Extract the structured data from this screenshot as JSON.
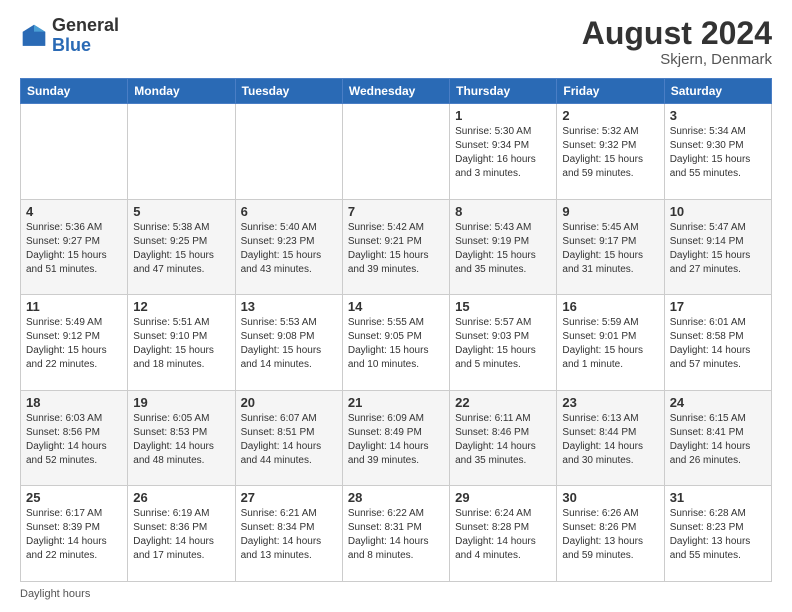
{
  "header": {
    "logo": {
      "general": "General",
      "blue": "Blue"
    },
    "title": "August 2024",
    "location": "Skjern, Denmark"
  },
  "calendar": {
    "days_of_week": [
      "Sunday",
      "Monday",
      "Tuesday",
      "Wednesday",
      "Thursday",
      "Friday",
      "Saturday"
    ],
    "weeks": [
      [
        {
          "day": "",
          "info": ""
        },
        {
          "day": "",
          "info": ""
        },
        {
          "day": "",
          "info": ""
        },
        {
          "day": "",
          "info": ""
        },
        {
          "day": "1",
          "info": "Sunrise: 5:30 AM\nSunset: 9:34 PM\nDaylight: 16 hours and 3 minutes."
        },
        {
          "day": "2",
          "info": "Sunrise: 5:32 AM\nSunset: 9:32 PM\nDaylight: 15 hours and 59 minutes."
        },
        {
          "day": "3",
          "info": "Sunrise: 5:34 AM\nSunset: 9:30 PM\nDaylight: 15 hours and 55 minutes."
        }
      ],
      [
        {
          "day": "4",
          "info": "Sunrise: 5:36 AM\nSunset: 9:27 PM\nDaylight: 15 hours and 51 minutes."
        },
        {
          "day": "5",
          "info": "Sunrise: 5:38 AM\nSunset: 9:25 PM\nDaylight: 15 hours and 47 minutes."
        },
        {
          "day": "6",
          "info": "Sunrise: 5:40 AM\nSunset: 9:23 PM\nDaylight: 15 hours and 43 minutes."
        },
        {
          "day": "7",
          "info": "Sunrise: 5:42 AM\nSunset: 9:21 PM\nDaylight: 15 hours and 39 minutes."
        },
        {
          "day": "8",
          "info": "Sunrise: 5:43 AM\nSunset: 9:19 PM\nDaylight: 15 hours and 35 minutes."
        },
        {
          "day": "9",
          "info": "Sunrise: 5:45 AM\nSunset: 9:17 PM\nDaylight: 15 hours and 31 minutes."
        },
        {
          "day": "10",
          "info": "Sunrise: 5:47 AM\nSunset: 9:14 PM\nDaylight: 15 hours and 27 minutes."
        }
      ],
      [
        {
          "day": "11",
          "info": "Sunrise: 5:49 AM\nSunset: 9:12 PM\nDaylight: 15 hours and 22 minutes."
        },
        {
          "day": "12",
          "info": "Sunrise: 5:51 AM\nSunset: 9:10 PM\nDaylight: 15 hours and 18 minutes."
        },
        {
          "day": "13",
          "info": "Sunrise: 5:53 AM\nSunset: 9:08 PM\nDaylight: 15 hours and 14 minutes."
        },
        {
          "day": "14",
          "info": "Sunrise: 5:55 AM\nSunset: 9:05 PM\nDaylight: 15 hours and 10 minutes."
        },
        {
          "day": "15",
          "info": "Sunrise: 5:57 AM\nSunset: 9:03 PM\nDaylight: 15 hours and 5 minutes."
        },
        {
          "day": "16",
          "info": "Sunrise: 5:59 AM\nSunset: 9:01 PM\nDaylight: 15 hours and 1 minute."
        },
        {
          "day": "17",
          "info": "Sunrise: 6:01 AM\nSunset: 8:58 PM\nDaylight: 14 hours and 57 minutes."
        }
      ],
      [
        {
          "day": "18",
          "info": "Sunrise: 6:03 AM\nSunset: 8:56 PM\nDaylight: 14 hours and 52 minutes."
        },
        {
          "day": "19",
          "info": "Sunrise: 6:05 AM\nSunset: 8:53 PM\nDaylight: 14 hours and 48 minutes."
        },
        {
          "day": "20",
          "info": "Sunrise: 6:07 AM\nSunset: 8:51 PM\nDaylight: 14 hours and 44 minutes."
        },
        {
          "day": "21",
          "info": "Sunrise: 6:09 AM\nSunset: 8:49 PM\nDaylight: 14 hours and 39 minutes."
        },
        {
          "day": "22",
          "info": "Sunrise: 6:11 AM\nSunset: 8:46 PM\nDaylight: 14 hours and 35 minutes."
        },
        {
          "day": "23",
          "info": "Sunrise: 6:13 AM\nSunset: 8:44 PM\nDaylight: 14 hours and 30 minutes."
        },
        {
          "day": "24",
          "info": "Sunrise: 6:15 AM\nSunset: 8:41 PM\nDaylight: 14 hours and 26 minutes."
        }
      ],
      [
        {
          "day": "25",
          "info": "Sunrise: 6:17 AM\nSunset: 8:39 PM\nDaylight: 14 hours and 22 minutes."
        },
        {
          "day": "26",
          "info": "Sunrise: 6:19 AM\nSunset: 8:36 PM\nDaylight: 14 hours and 17 minutes."
        },
        {
          "day": "27",
          "info": "Sunrise: 6:21 AM\nSunset: 8:34 PM\nDaylight: 14 hours and 13 minutes."
        },
        {
          "day": "28",
          "info": "Sunrise: 6:22 AM\nSunset: 8:31 PM\nDaylight: 14 hours and 8 minutes."
        },
        {
          "day": "29",
          "info": "Sunrise: 6:24 AM\nSunset: 8:28 PM\nDaylight: 14 hours and 4 minutes."
        },
        {
          "day": "30",
          "info": "Sunrise: 6:26 AM\nSunset: 8:26 PM\nDaylight: 13 hours and 59 minutes."
        },
        {
          "day": "31",
          "info": "Sunrise: 6:28 AM\nSunset: 8:23 PM\nDaylight: 13 hours and 55 minutes."
        }
      ]
    ]
  },
  "footer": {
    "daylight_hours": "Daylight hours"
  }
}
